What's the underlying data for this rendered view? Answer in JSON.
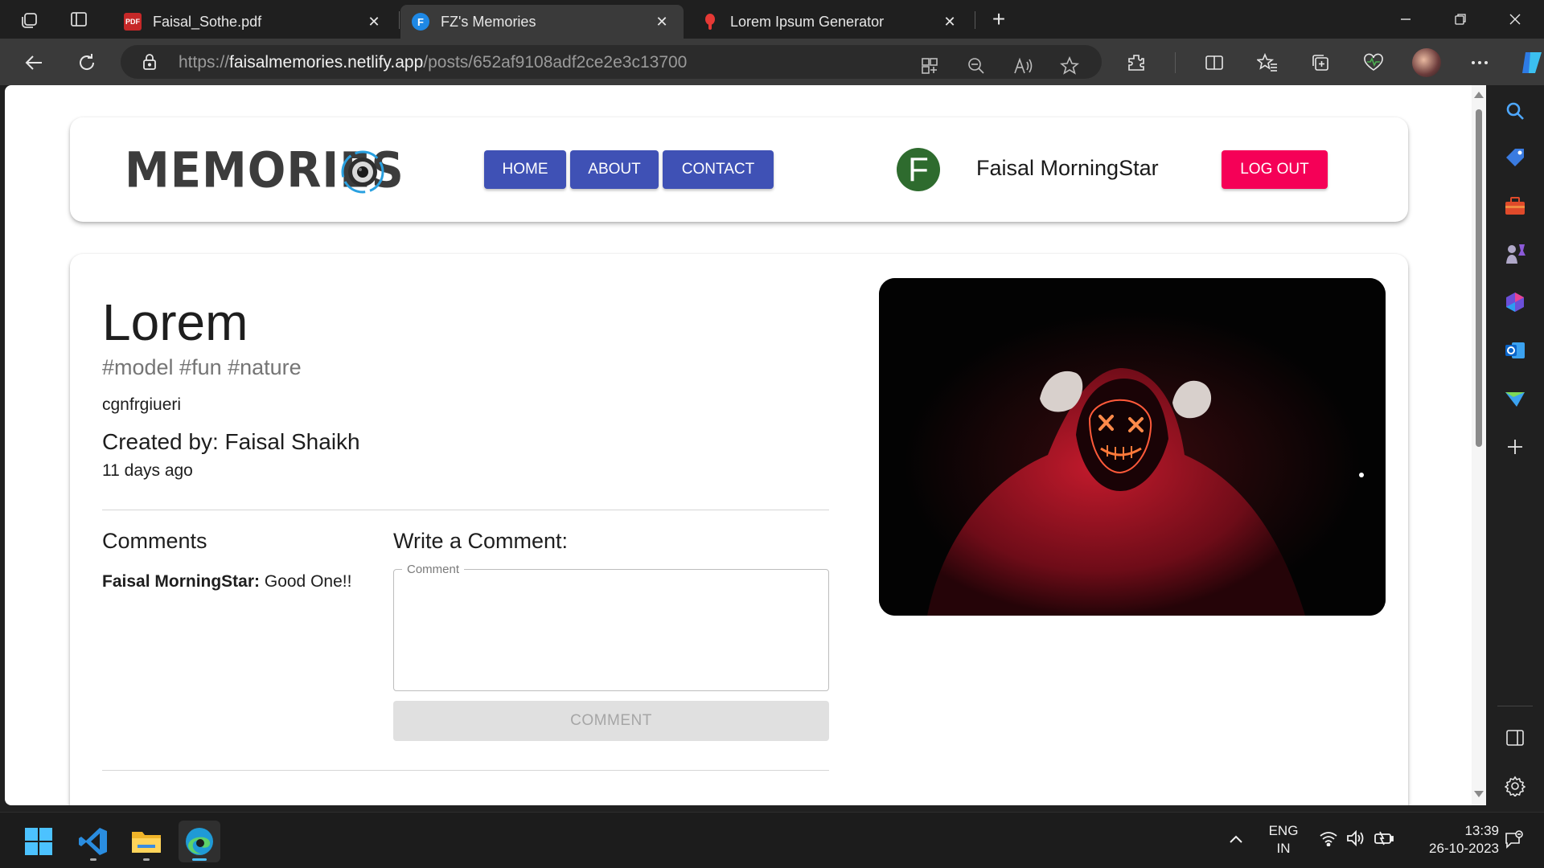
{
  "browser": {
    "tabs": [
      {
        "title": "Faisal_Sothe.pdf",
        "favicon": "pdf-icon",
        "active": false
      },
      {
        "title": "FZ's Memories",
        "favicon": "F",
        "active": true
      },
      {
        "title": "Lorem Ipsum Generator",
        "favicon": "lorem-icon",
        "active": false
      }
    ],
    "url_scheme": "https://",
    "url_host": "faisalmemories.netlify.app",
    "url_path": "/posts/652af9108adf2ce2e3c13700",
    "accent": "#4cc2ff"
  },
  "navbar": {
    "brand": "MEMORIES",
    "links": [
      "HOME",
      "ABOUT",
      "CONTACT"
    ],
    "user_initial": "F",
    "user_name": "Faisal MorningStar",
    "logout_label": "LOG OUT",
    "primary_color": "#3f51b5",
    "secondary_color": "#f50057"
  },
  "post": {
    "title": "Lorem",
    "tags": "#model #fun #nature",
    "message": "cgnfrgiueri",
    "created_by": "Created by: Faisal Shaikh",
    "time_ago": "11 days ago",
    "image_alt": "person in red hoodie wearing glowing mask"
  },
  "comments": {
    "heading": "Comments",
    "items": [
      {
        "author": "Faisal MorningStar:",
        "text": " Good One!!"
      }
    ],
    "write_heading": "Write a Comment:",
    "field_label": "Comment",
    "button_label": "COMMENT"
  },
  "taskbar": {
    "language": "ENG",
    "region": "IN",
    "time": "13:39",
    "date": "26-10-2023"
  }
}
